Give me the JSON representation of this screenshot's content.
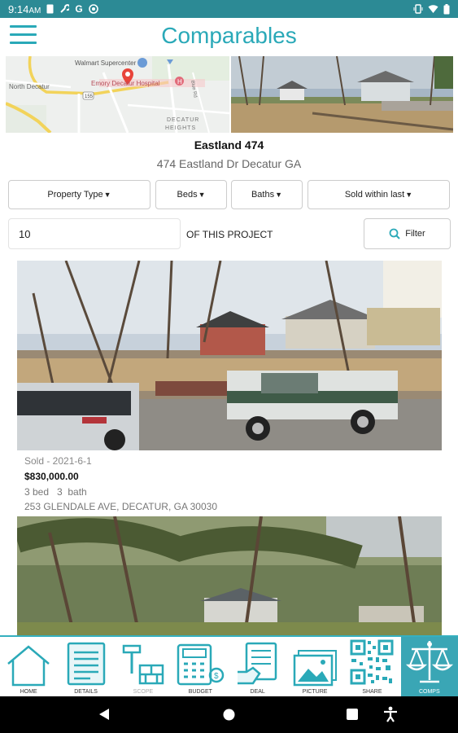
{
  "status_bar": {
    "time": "9:14",
    "am_pm": "AM",
    "icons_left": [
      "sim-icon",
      "wrench-icon",
      "google-icon",
      "sync-icon"
    ],
    "icons_right": [
      "vibrate-icon",
      "wifi-icon",
      "battery-icon"
    ]
  },
  "header": {
    "title": "Comparables"
  },
  "map": {
    "labels": [
      "Walmart Supercenter",
      "North Decatur",
      "Emory Decatur Hospital",
      "DECATUR",
      "HEIGHTS",
      "Blue Rd"
    ],
    "route_badge": "155"
  },
  "property": {
    "name": "Eastland 474",
    "address": "474 Eastland Dr Decatur GA"
  },
  "filters": {
    "property_type": "Property Type",
    "beds": "Beds",
    "baths": "Baths",
    "sold_within": "Sold within last"
  },
  "count": {
    "value": "10",
    "suffix": "OF THIS PROJECT"
  },
  "filter_button": {
    "label": "Filter"
  },
  "comparables": [
    {
      "sold": "Sold - 2021-6-1",
      "price": "$830,000.00",
      "bed_bath": "3 bed   3  bath",
      "address": "253 GLENDALE AVE, DECATUR, GA 30030"
    }
  ],
  "bottom_nav": [
    {
      "label": "HOME",
      "icon": "house-icon"
    },
    {
      "label": "DETAILS",
      "icon": "document-icon"
    },
    {
      "label": "SCOPE",
      "icon": "tools-icon"
    },
    {
      "label": "BUDGET",
      "icon": "calculator-icon"
    },
    {
      "label": "DEAL",
      "icon": "handshake-icon"
    },
    {
      "label": "PICTURE",
      "icon": "picture-icon"
    },
    {
      "label": "SHARE",
      "icon": "qr-code-icon"
    },
    {
      "label": "COMPS",
      "icon": "scales-icon"
    }
  ],
  "colors": {
    "accent": "#2aa9b8",
    "status_bar": "#2c8a95",
    "active_nav": "#3aa6b5",
    "map_pin": "#e8443a"
  }
}
